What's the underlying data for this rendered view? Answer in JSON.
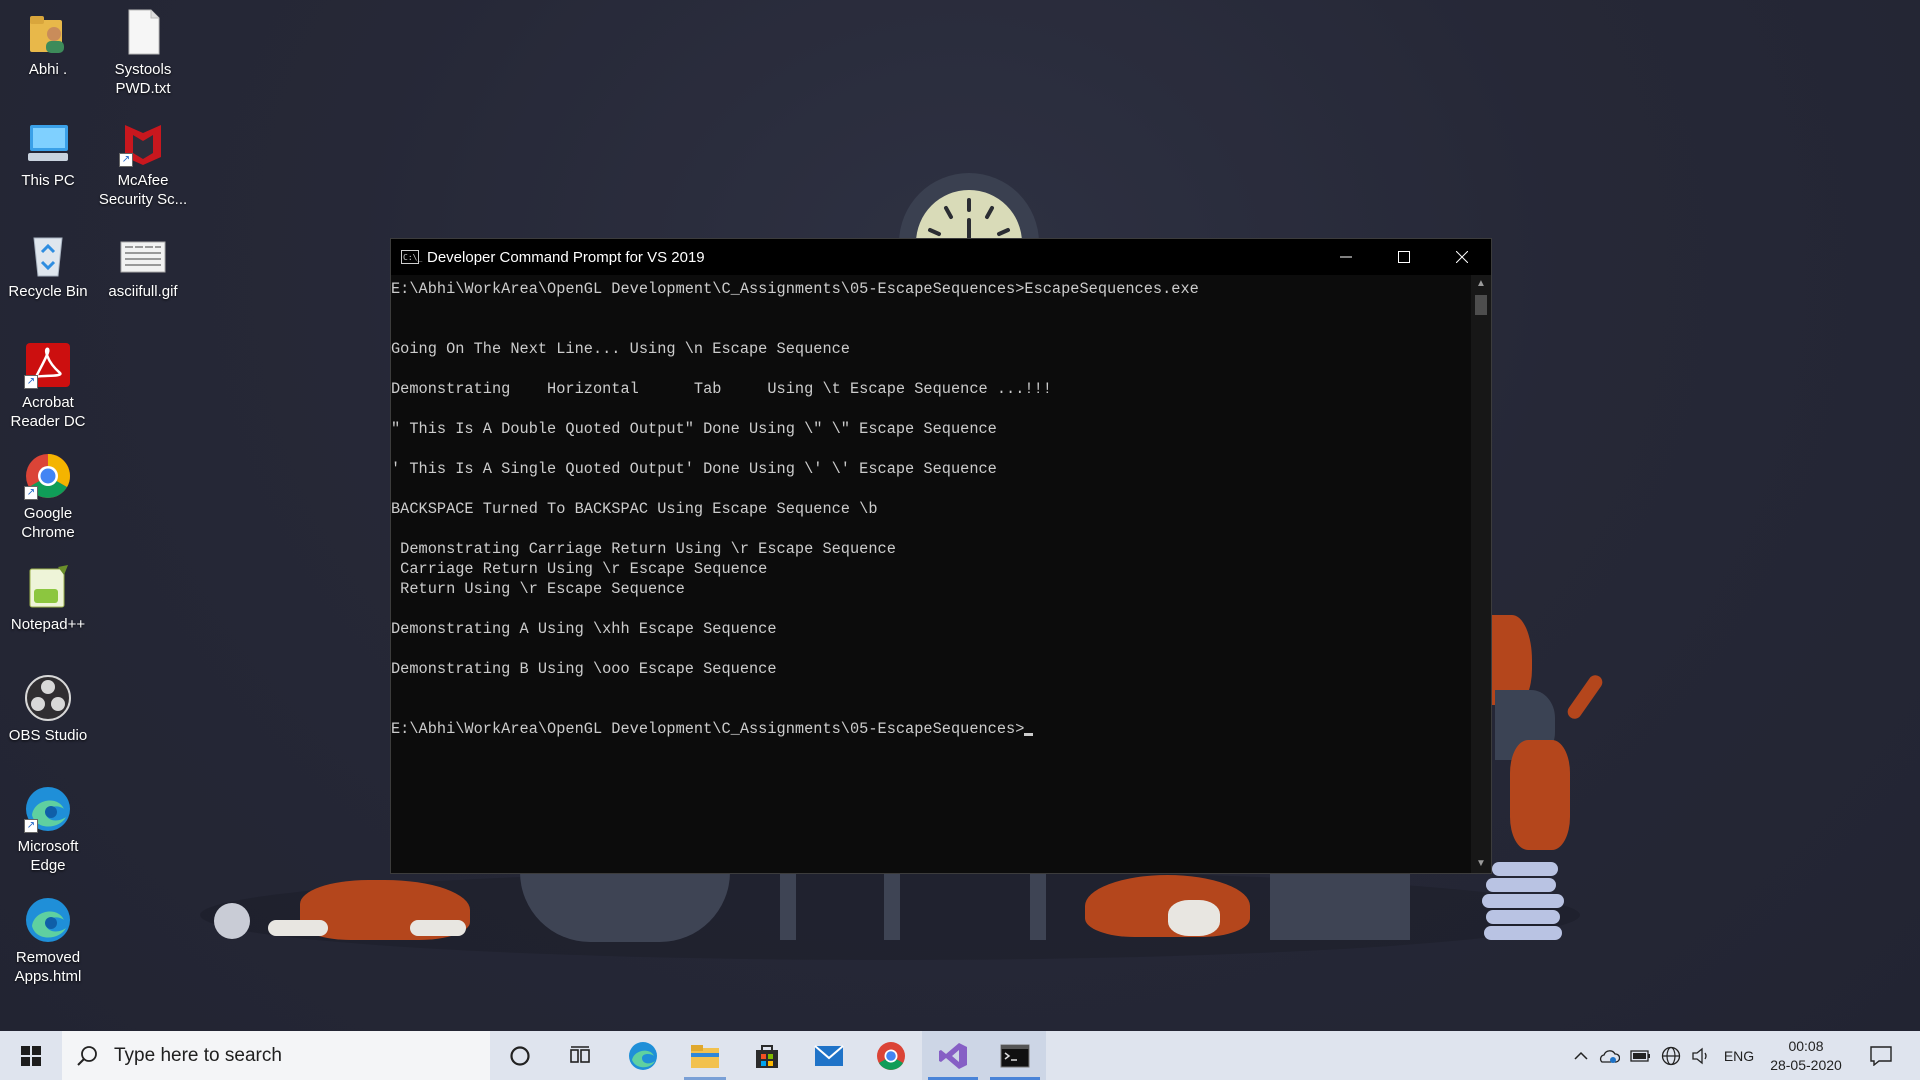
{
  "desktop": {
    "icons": [
      {
        "label": "Abhi .",
        "icon": "user-folder-icon"
      },
      {
        "label": "Systools PWD.txt",
        "icon": "text-file-icon"
      },
      {
        "label": "This PC",
        "icon": "computer-icon"
      },
      {
        "label": "McAfee Security Sc...",
        "icon": "mcafee-icon"
      },
      {
        "label": "Recycle Bin",
        "icon": "recycle-bin-icon"
      },
      {
        "label": "asciifull.gif",
        "icon": "image-file-icon"
      },
      {
        "label": "Acrobat Reader DC",
        "icon": "acrobat-icon"
      },
      {
        "label": "Google Chrome",
        "icon": "chrome-icon"
      },
      {
        "label": "Notepad++",
        "icon": "notepadpp-icon"
      },
      {
        "label": "OBS Studio",
        "icon": "obs-icon"
      },
      {
        "label": "Microsoft Edge",
        "icon": "edge-icon"
      },
      {
        "label": "Removed Apps.html",
        "icon": "edge-html-icon"
      }
    ]
  },
  "console": {
    "title": "Developer Command Prompt for VS 2019",
    "app_icon_text": "C:\\_",
    "lines": [
      "E:\\Abhi\\WorkArea\\OpenGL Development\\C_Assignments\\05-EscapeSequences>EscapeSequences.exe",
      "",
      "",
      "Going On The Next Line... Using \\n Escape Sequence",
      "",
      "Demonstrating    Horizontal      Tab     Using \\t Escape Sequence ...!!!",
      "",
      "\" This Is A Double Quoted Output\" Done Using \\\" \\\" Escape Sequence",
      "",
      "' This Is A Single Quoted Output' Done Using \\' \\' Escape Sequence",
      "",
      "BACKSPACE Turned To BACKSPAC Using Escape Sequence \\b",
      "",
      " Demonstrating Carriage Return Using \\r Escape Sequence",
      " Carriage Return Using \\r Escape Sequence",
      " Return Using \\r Escape Sequence",
      "",
      "Demonstrating A Using \\xhh Escape Sequence",
      "",
      "Demonstrating B Using \\ooo Escape Sequence",
      "",
      "",
      "E:\\Abhi\\WorkArea\\OpenGL Development\\C_Assignments\\05-EscapeSequences>"
    ],
    "buttons": {
      "minimize": "minimize-icon",
      "maximize": "maximize-icon",
      "close": "close-icon"
    }
  },
  "taskbar": {
    "search_placeholder": "Type here to search",
    "pinned": [
      "cortana-icon",
      "task-view-icon",
      "edge-icon",
      "file-explorer-icon",
      "store-icon",
      "mail-icon",
      "chrome-icon",
      "visual-studio-icon",
      "command-prompt-icon"
    ],
    "tray": {
      "language": "ENG",
      "time": "00:08",
      "date": "28-05-2020"
    }
  },
  "colors": {
    "desktop_bg": "#262837",
    "console_bg": "#0c0c0c",
    "console_text": "#cccccc",
    "taskbar_bg": "#dfe4ee",
    "accent": "#4a84d8"
  }
}
